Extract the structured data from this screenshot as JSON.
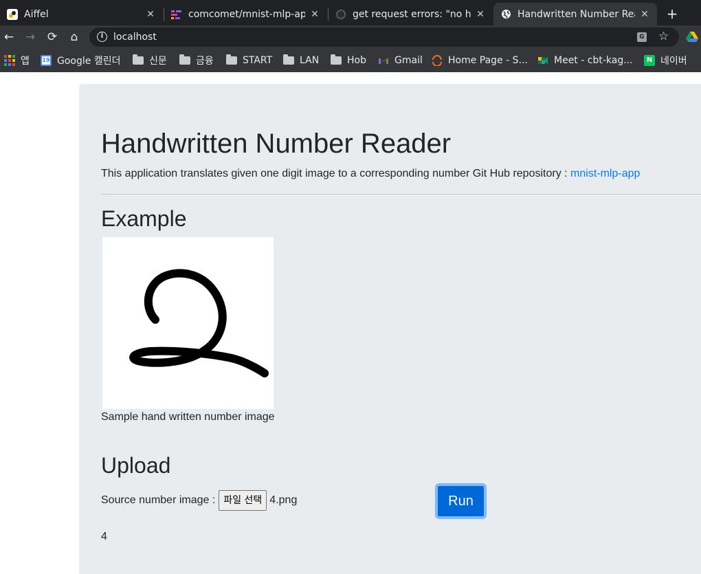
{
  "browser": {
    "tabs": [
      {
        "title": "Aiffel",
        "icon": "aiffel-favicon",
        "active": false
      },
      {
        "title": "comcomet/mnist-mlp-app",
        "icon": "gitlab-favicon",
        "active": false
      },
      {
        "title": "get request errors: \"no he",
        "icon": "github-favicon",
        "active": false
      },
      {
        "title": "Handwritten Number Rea",
        "icon": "globe-icon",
        "active": true
      }
    ],
    "url": "localhost",
    "bookmarks": [
      {
        "label": "앱",
        "icon": "apps-grid-icon"
      },
      {
        "label": "Google 캘린더",
        "icon": "google-calendar-icon",
        "badge": "19"
      },
      {
        "label": "신문",
        "icon": "folder-icon"
      },
      {
        "label": "금융",
        "icon": "folder-icon"
      },
      {
        "label": "START",
        "icon": "folder-icon"
      },
      {
        "label": "LAN",
        "icon": "folder-icon"
      },
      {
        "label": "Hob",
        "icon": "folder-icon"
      },
      {
        "label": "Gmail",
        "icon": "gmail-icon"
      },
      {
        "label": "Home Page - S...",
        "icon": "home-page-icon"
      },
      {
        "label": "Meet - cbt-kag...",
        "icon": "meet-icon"
      },
      {
        "label": "네이버",
        "icon": "naver-icon",
        "badge": "N"
      }
    ],
    "translate_badge": "G"
  },
  "page": {
    "title": "Handwritten Number Reader",
    "lead_text": "This application translates given one digit image to a corresponding number Git Hub repository : ",
    "lead_link": "mnist-mlp-app",
    "example_heading": "Example",
    "example_caption": "Sample hand written number image",
    "upload_heading": "Upload",
    "source_label": "Source number image : ",
    "file_button_label": "파일 선택",
    "file_name": "4.png",
    "run_label": "Run",
    "result": "4"
  },
  "colors": {
    "tab_bar": "#202124",
    "toolbar": "#35363a",
    "jumbotron": "#e9ecef",
    "link": "#007bff",
    "run_button": "#0069d9"
  }
}
